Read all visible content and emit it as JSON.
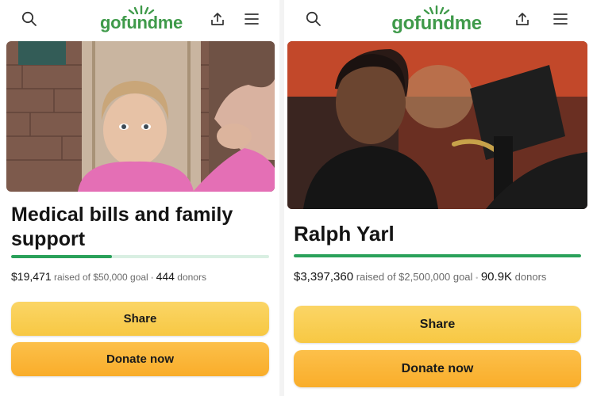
{
  "brand": {
    "logo_text": "gofundme",
    "logo_color": "#3f9a4a",
    "progress_color": "#2aa15a",
    "share_color": "#f8cd52",
    "donate_color": "#fbb637"
  },
  "topbar": {
    "icons": [
      "search-icon",
      "share-upload-icon",
      "menu-icon"
    ]
  },
  "campaigns": [
    {
      "title": "Medical bills and family support",
      "raised": "$19,471",
      "raised_text": "raised of $50,000 goal",
      "separator": "•",
      "donors": "444",
      "donors_label": "donors",
      "progress": 0.39,
      "share_label": "Share",
      "donate_label": "Donate now"
    },
    {
      "title": "Ralph Yarl",
      "raised": "$3,397,360",
      "raised_text": "raised of $2,500,000 goal",
      "separator": "•",
      "donors": "90.9K",
      "donors_label": "donors",
      "progress": 1.0,
      "share_label": "Share",
      "donate_label": "Donate now"
    }
  ]
}
